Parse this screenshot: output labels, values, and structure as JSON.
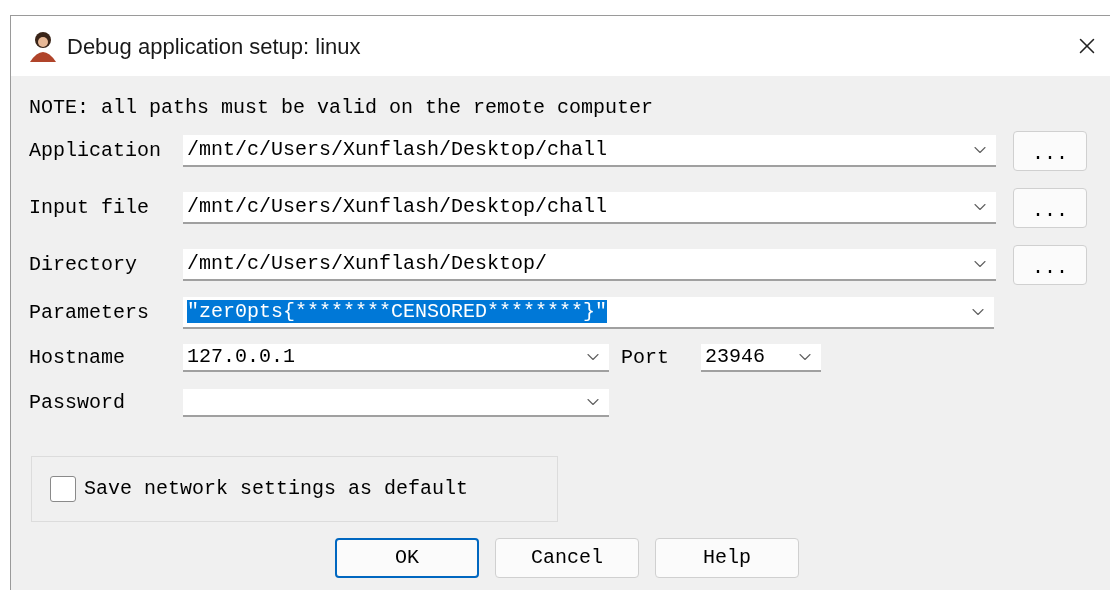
{
  "window": {
    "title": "Debug application setup: linux"
  },
  "note": "NOTE: all paths must be valid on the remote computer",
  "path_fields": [
    {
      "label": "Application",
      "value": "/mnt/c/Users/Xunflash/Desktop/chall",
      "browse": "..."
    },
    {
      "label": "Input file",
      "value": "/mnt/c/Users/Xunflash/Desktop/chall",
      "browse": "..."
    },
    {
      "label": "Directory",
      "value": "/mnt/c/Users/Xunflash/Desktop/",
      "browse": "..."
    }
  ],
  "parameters": {
    "label": "Parameters",
    "value": "″zer0pts{********CENSORED********}″",
    "text_selected": true
  },
  "hostname": {
    "label": "Hostname",
    "value": "127.0.0.1"
  },
  "port": {
    "label": "Port",
    "value": "23946"
  },
  "password": {
    "label": "Password"
  },
  "save_default": {
    "label": "Save network settings as default",
    "checked": false
  },
  "buttons": [
    {
      "label": "OK",
      "default": true
    },
    {
      "label": "Cancel",
      "default": false
    },
    {
      "label": "Help",
      "default": false
    }
  ]
}
